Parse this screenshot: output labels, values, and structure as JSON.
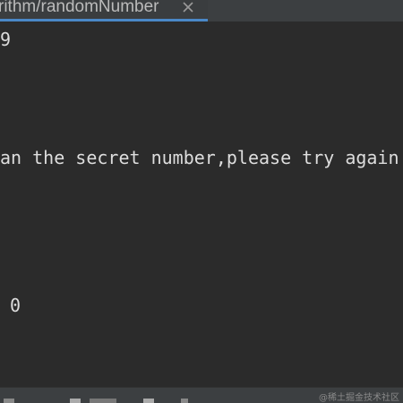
{
  "tab": {
    "title": "rithm/randomNumber",
    "close_icon": "close-icon"
  },
  "console": {
    "lines": [
      "9",
      "an the secret number,please try again",
      "0"
    ]
  },
  "status_bar": {
    "icons": [
      "run-icon",
      "terminal-icon",
      "todo-icon",
      "problems-icon",
      "services-icon"
    ],
    "watermark": "@稀土掘金技术社区"
  },
  "colors": {
    "editor_bg": "#2b2b2b",
    "tab_bg": "#3c3f41",
    "tab_underline": "#4a88c7",
    "text": "#dddddd"
  }
}
